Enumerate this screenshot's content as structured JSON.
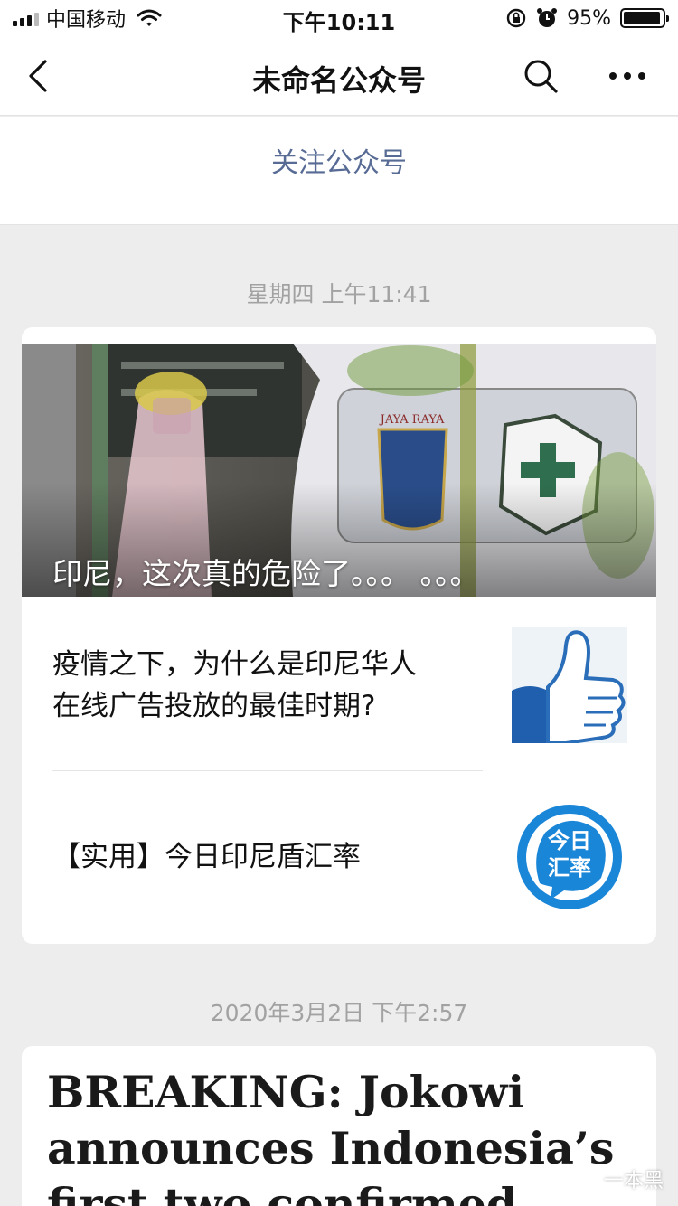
{
  "status_bar": {
    "carrier": "中国移动",
    "time": "下午10:11",
    "battery_percent": "95%",
    "battery_level": 0.95
  },
  "nav": {
    "title": "未命名公众号"
  },
  "follow_label": "关注公众号",
  "messages": [
    {
      "timestamp": "星期四 上午11:41",
      "cover_title": "印尼，这次真的危险了。。。 。。。",
      "items": [
        {
          "title_line1": "疫情之下，为什么是印尼华人",
          "title_line2": "在线广告投放的最佳时期?",
          "thumb_icon": "thumbs-up-icon"
        },
        {
          "title_line1": "【实用】今日印尼盾汇率",
          "thumb_icon": "exchange-rate-icon",
          "thumb_text_1": "今日",
          "thumb_text_2": "汇率"
        }
      ]
    },
    {
      "timestamp": "2020年3月2日 下午2:57",
      "breaking_line1": "BREAKING: Jokowi",
      "breaking_line2": "announces Indonesia’s",
      "breaking_line3": "first two confirmed"
    }
  ],
  "watermark": "一本黑",
  "colors": {
    "link_blue": "#576b95",
    "rate_blue": "#1a86d8"
  }
}
